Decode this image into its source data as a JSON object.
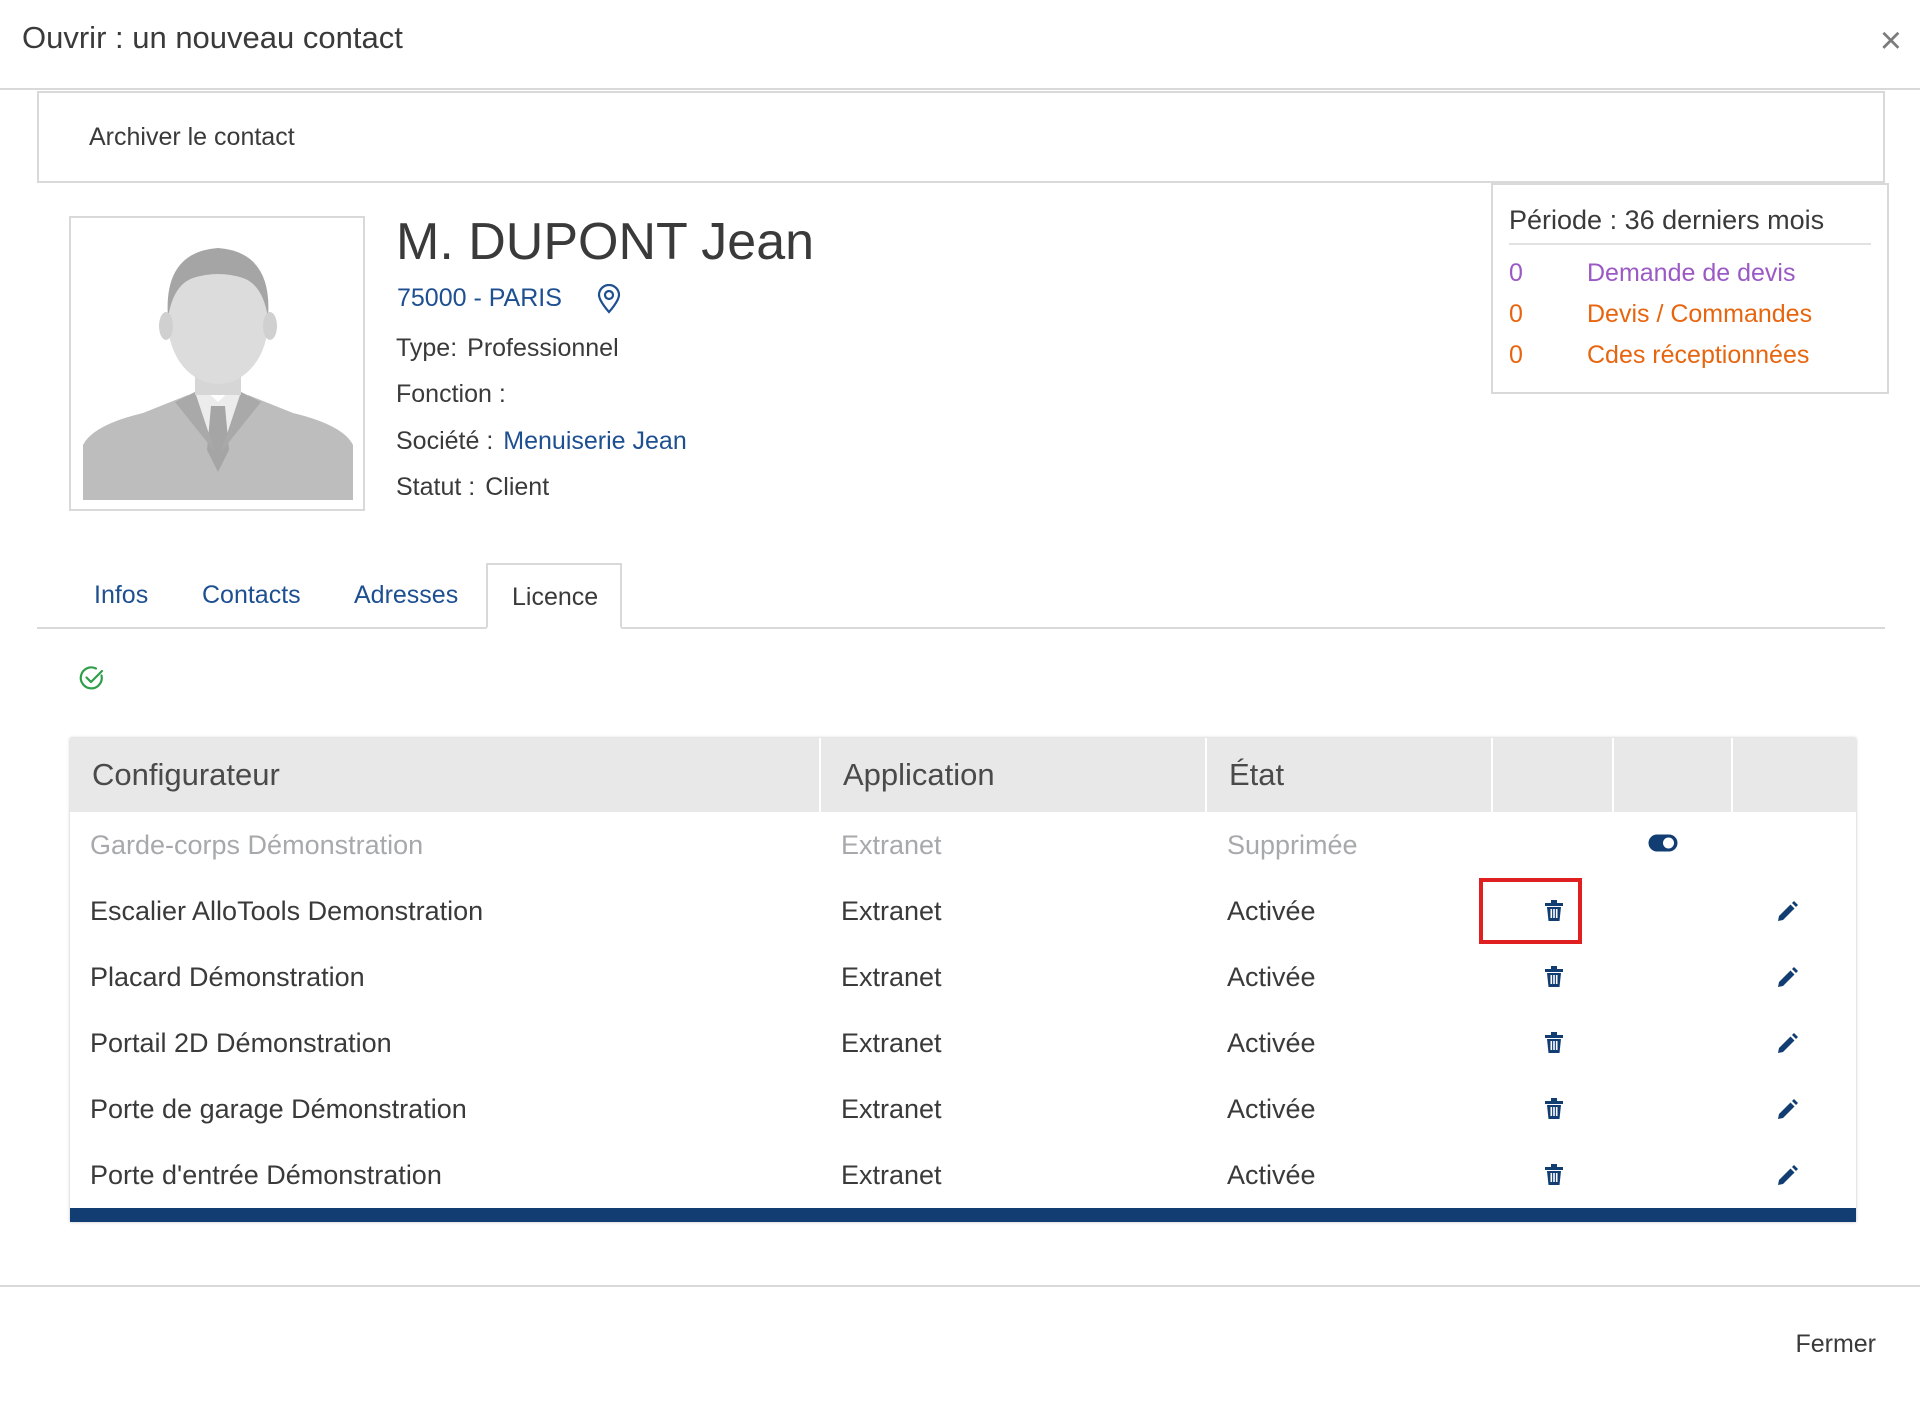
{
  "modal": {
    "title": "Ouvrir : un nouveau contact",
    "close_icon": "×"
  },
  "archive": {
    "label": "Archiver le contact"
  },
  "contact": {
    "name": "M. DUPONT Jean",
    "city": "75000 - PARIS",
    "type_label": "Type:",
    "type_value": "Professionnel",
    "fonction_label": "Fonction :",
    "fonction_value": "",
    "societe_label": "Société :",
    "societe_value": "Menuiserie Jean",
    "statut_label": "Statut :",
    "statut_value": "Client"
  },
  "stats": {
    "title": "Période : 36 derniers mois",
    "rows": [
      {
        "count": "0",
        "label": "Demande de devis",
        "color": "#9b59c5"
      },
      {
        "count": "0",
        "label": "Devis / Commandes",
        "color": "#e8650f"
      },
      {
        "count": "0",
        "label": "Cdes réceptionnées",
        "color": "#e8650f"
      }
    ]
  },
  "tabs": [
    {
      "label": "Infos"
    },
    {
      "label": "Contacts"
    },
    {
      "label": "Adresses"
    },
    {
      "label": "Licence",
      "active": true
    }
  ],
  "table": {
    "headers": [
      "Configurateur",
      "Application",
      "État",
      "",
      "",
      ""
    ],
    "rows": [
      {
        "configurateur": "Garde-corps Démonstration",
        "application": "Extranet",
        "etat": "Supprimée",
        "deleted": true
      },
      {
        "configurateur": "Escalier AlloTools Demonstration",
        "application": "Extranet",
        "etat": "Activée"
      },
      {
        "configurateur": "Placard Démonstration",
        "application": "Extranet",
        "etat": "Activée"
      },
      {
        "configurateur": "Portail 2D Démonstration",
        "application": "Extranet",
        "etat": "Activée"
      },
      {
        "configurateur": "Porte de garage Démonstration",
        "application": "Extranet",
        "etat": "Activée"
      },
      {
        "configurateur": "Porte d'entrée Démonstration",
        "application": "Extranet",
        "etat": "Activée"
      }
    ]
  },
  "footer": {
    "close_label": "Fermer"
  },
  "colors": {
    "link": "#1d4f91",
    "icon": "#123d73",
    "accent_bar": "#123d73",
    "highlight": "#e02020",
    "success": "#2e9e48"
  }
}
